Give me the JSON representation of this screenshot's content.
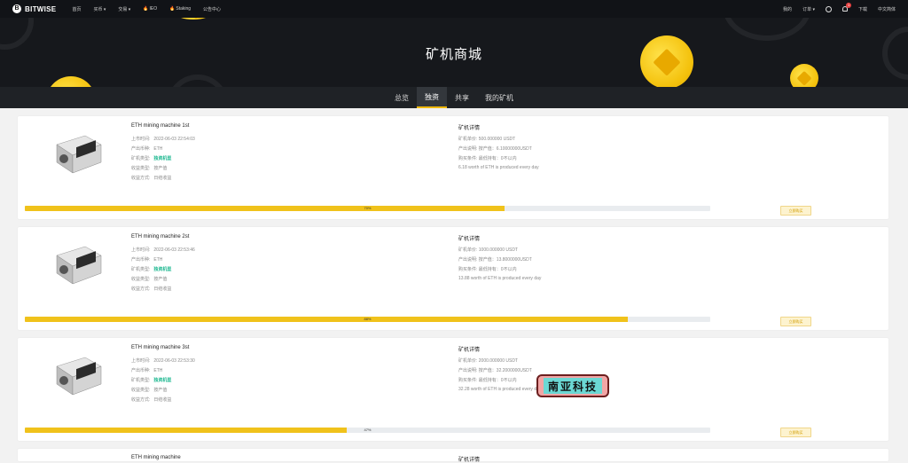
{
  "brand": {
    "logo_letter": "B",
    "name": "BITWISE"
  },
  "nav": {
    "left": [
      "首页",
      "买币 ▾",
      "交易 ▾",
      "IEO",
      "Staking",
      "公告中心"
    ],
    "right": [
      "我的",
      "订单 ▾",
      "下载",
      "中文简体"
    ],
    "notification_count": "1"
  },
  "hero": {
    "title": "矿机商城"
  },
  "tabs": [
    "总览",
    "独资",
    "共享",
    "我的矿机"
  ],
  "active_tab": 1,
  "labels": {
    "list_time": "上市时间:",
    "product": "产出币种:",
    "type": "矿机类型:",
    "income_type": "收益类型:",
    "income_method": "收益方式:",
    "detail_title": "矿机详情",
    "price": "矿机单价:",
    "output": "产出说明:",
    "purchase": "购买条件:",
    "buy": "立即购买"
  },
  "miners": [
    {
      "name": "ETH mining machine 1st",
      "list_time": "2022-06-03 22:54:03",
      "coin": "ETH",
      "type": "独资机型",
      "income_type": "按产值",
      "income_method": "日结收益",
      "price": "500.000000 USDT",
      "output": "按产值：6.10000000USDT",
      "purchase": "最低持有：0不以内",
      "note": "6.18 worth of ETH is produced every day",
      "progress": 70,
      "progress_label": "70%"
    },
    {
      "name": "ETH mining machine 2st",
      "list_time": "2022-06-03 22:53:46",
      "coin": "ETH",
      "type": "独资机型",
      "income_type": "按产值",
      "income_method": "日结收益",
      "price": "1000.000000 USDT",
      "output": "按产值：13.8000000USDT",
      "purchase": "最低持有：0不以内",
      "note": "13.88 worth of ETH is produced every day",
      "progress": 88,
      "progress_label": "88%"
    },
    {
      "name": "ETH mining machine 3st",
      "list_time": "2022-06-03 22:53:30",
      "coin": "ETH",
      "type": "独资机型",
      "income_type": "按产值",
      "income_method": "日结收益",
      "price": "2000.000000 USDT",
      "output": "按产值：32.2000000USDT",
      "purchase": "最低持有：0不以内",
      "note": "32.28 worth of ETH is produced every day",
      "progress": 47,
      "progress_label": "47%"
    },
    {
      "name": "ETH mining machine",
      "detail_title": "矿机详情"
    }
  ],
  "stamp": {
    "text": "南亚科技"
  }
}
